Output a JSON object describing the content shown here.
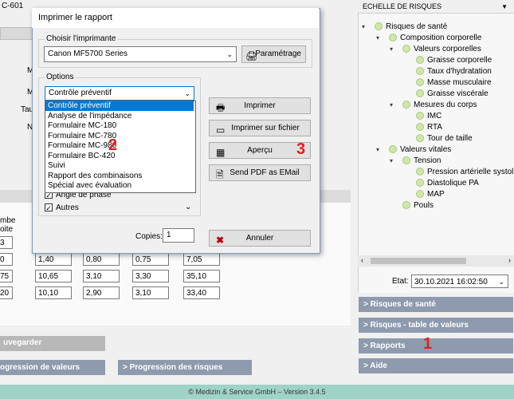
{
  "background": {
    "title": "C-601",
    "labels_left": [
      "M",
      "M",
      "Tau",
      "N"
    ],
    "table_head": [
      "mbe",
      "oite"
    ],
    "table_rows": [
      [
        "3",
        "",
        "",
        "",
        ""
      ],
      [
        "0",
        "1,40",
        "0,80",
        "0,75",
        "7,05"
      ],
      [
        "75",
        "10,65",
        "3,10",
        "3,30",
        "35,10"
      ],
      [
        "20",
        "10,10",
        "2,90",
        "3,10",
        "33,40"
      ]
    ],
    "save_label": "uvegarder",
    "progress_values_label": "ogression de valeurs",
    "progress_risks_label": "> Progression des risques",
    "footer": "© Medizin & Service GmbH – Version 3.4.5"
  },
  "right_panel": {
    "header": "ECHELLE DE RISQUES",
    "tree": [
      "Risques de santé",
      "Composition corporelle",
      "Valeurs corporelles",
      "Graisse corporelle",
      "Taux d'hydratation",
      "Masse musculaire",
      "Graisse viscérale",
      "Mesures du corps",
      "IMC",
      "RTA",
      "Tour de taille",
      "Valeurs vitales",
      "Tension",
      "Pression artérielle systolique",
      "Diastolique PA",
      "MAP",
      "Pouls"
    ],
    "date_label": "Etat:",
    "date_value": "30.10.2021 16:02:50",
    "nav": [
      "> Risques de santé",
      "> Risques - table de valeurs",
      "> Rapports",
      "> Aide"
    ]
  },
  "dialog": {
    "title": "Imprimer le rapport",
    "printer_group": "Choisir l'imprimante",
    "printer_value": "Canon MF5700 Series",
    "setup_button": "Paramétrage",
    "options_group": "Options",
    "report_value": "Contrôle préventif",
    "report_options": [
      "Contrôle préventif",
      "Analyse de l'impédance",
      "Formulaire MC-180",
      "Formulaire MC-780",
      "Formulaire MC-980",
      "Formulaire BC-420",
      "Suivi",
      "Rapport des combinaisons",
      "Spécial avec évaluation"
    ],
    "checkboxes": [
      "Angle de phase",
      "Autres"
    ],
    "copies_label": "Copies:",
    "copies_value": "1",
    "print_button": "Imprimer",
    "print_file_button": "Imprimer sur fichier",
    "preview_button": "Aperçu",
    "send_pdf_button": "Send PDF as EMail",
    "cancel_button": "Annuler"
  },
  "markers": [
    "1",
    "2",
    "3"
  ],
  "colors": {
    "accent_red": "#e02020",
    "nav_bg": "#8e9aad",
    "footer_bg": "#9fd3c7",
    "selection": "#0078d7"
  }
}
